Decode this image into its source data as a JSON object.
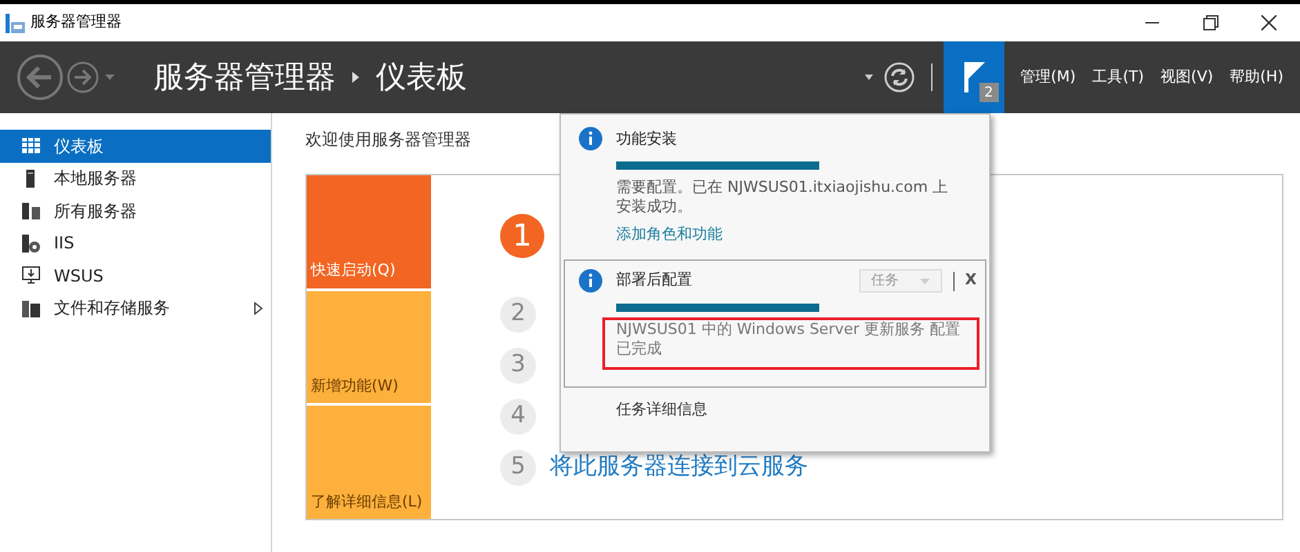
{
  "window": {
    "title": "服务器管理器"
  },
  "header": {
    "breadcrumb": [
      "服务器管理器",
      "仪表板"
    ],
    "notification_count": "2",
    "menus": [
      "管理(M)",
      "工具(T)",
      "视图(V)",
      "帮助(H)"
    ]
  },
  "sidebar": {
    "items": [
      {
        "label": "仪表板",
        "kind": "dashboard",
        "selected": true,
        "has_submenu": false
      },
      {
        "label": "本地服务器",
        "kind": "server",
        "selected": false,
        "has_submenu": false
      },
      {
        "label": "所有服务器",
        "kind": "servers",
        "selected": false,
        "has_submenu": false
      },
      {
        "label": "IIS",
        "kind": "iis",
        "selected": false,
        "has_submenu": false
      },
      {
        "label": "WSUS",
        "kind": "wsus",
        "selected": false,
        "has_submenu": false
      },
      {
        "label": "文件和存储服务",
        "kind": "files",
        "selected": false,
        "has_submenu": true
      }
    ]
  },
  "content": {
    "heading": "欢迎使用服务器管理器",
    "tiles": [
      {
        "label": "快速启动(Q)",
        "color": "#f26522"
      },
      {
        "label": "新增功能(W)",
        "color": "#fdb03c"
      },
      {
        "label": "了解详细信息(L)",
        "color": "#fdb03c"
      }
    ],
    "steps": [
      {
        "number": "1",
        "kind": "primary"
      },
      {
        "number": "2",
        "kind": "secondary"
      },
      {
        "number": "3",
        "kind": "secondary"
      },
      {
        "number": "4",
        "kind": "secondary"
      },
      {
        "number": "5",
        "label": "将此服务器连接到云服务",
        "kind": "secondary"
      }
    ]
  },
  "notifications": [
    {
      "title": "功能安装",
      "level": 1,
      "message": "需要配置。已在 NJWSUS01.itxiaojishu.com 上安装成功。",
      "link": "添加角色和功能",
      "selected": false,
      "highlighted": false
    },
    {
      "title": "部署后配置",
      "level": 1,
      "message": "NJWSUS01 中的 Windows Server 更新服务 配置已完成",
      "tasks_button": "任务",
      "close": "X",
      "selected": true,
      "highlighted": true
    }
  ],
  "task_details": "任务详细信息"
}
